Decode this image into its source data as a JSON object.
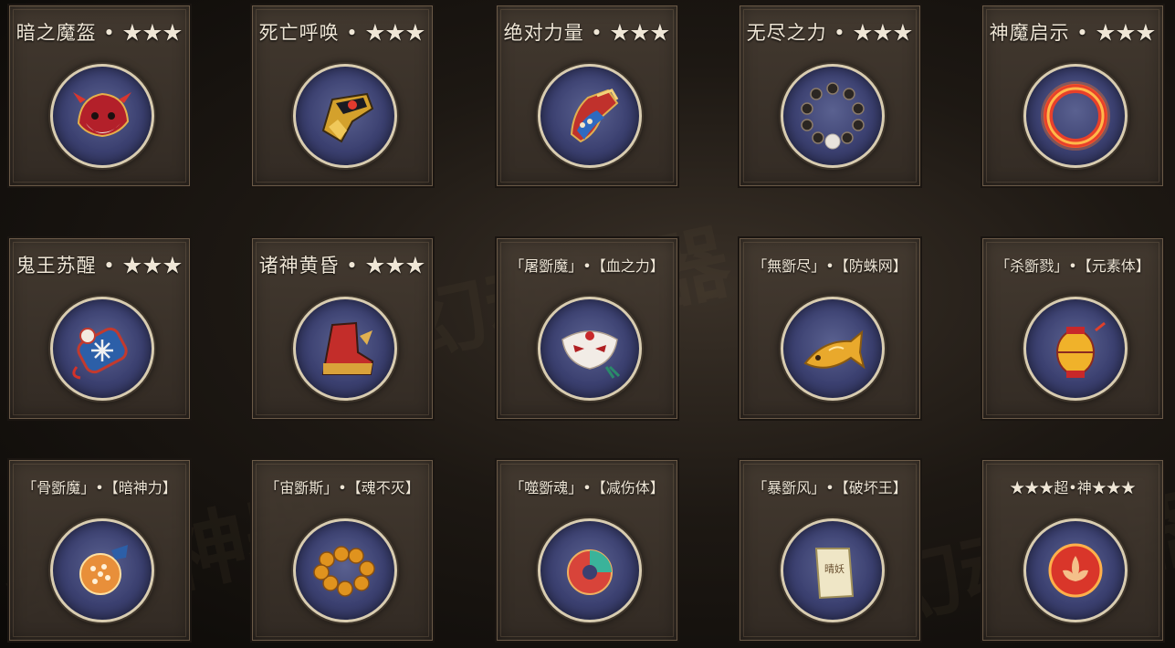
{
  "watermark_text": "幻魂神器",
  "items": [
    {
      "title": "暗之魔盔 • ★★★",
      "icon": "demon-helmet-icon",
      "small": false
    },
    {
      "title": "死亡呼唤 • ★★★",
      "icon": "golden-gauntlet-icon",
      "small": false
    },
    {
      "title": "绝对力量 • ★★★",
      "icon": "power-gauntlet-icon",
      "small": false
    },
    {
      "title": "无尽之力 • ★★★",
      "icon": "bead-bracelet-icon",
      "small": false
    },
    {
      "title": "神魔启示 • ★★★",
      "icon": "fire-ring-icon",
      "small": false
    },
    {
      "title": "鬼王苏醒 • ★★★",
      "icon": "ghost-charm-icon",
      "small": false
    },
    {
      "title": "诸神黄昏 • ★★★",
      "icon": "red-boots-icon",
      "small": false
    },
    {
      "title": "「屠斵魔」•【血之力】",
      "icon": "fox-mask-icon",
      "small": true
    },
    {
      "title": "「無斵尽」•【防蛛网】",
      "icon": "golden-fish-icon",
      "small": true
    },
    {
      "title": "「杀斵戮」•【元素体】",
      "icon": "lantern-icon",
      "small": true
    },
    {
      "title": "「骨斵魔」•【暗神力】",
      "icon": "spirit-orb-icon",
      "small": true
    },
    {
      "title": "「宙斵斯」•【魂不灭】",
      "icon": "amber-beads-icon",
      "small": true
    },
    {
      "title": "「噬斵魂」•【减伤体】",
      "icon": "jade-disc-icon",
      "small": true
    },
    {
      "title": "「暴斵风」•【破坏王】",
      "icon": "talisman-icon",
      "small": true,
      "talisman_text": "晴妖"
    },
    {
      "title": "★★★超•神★★★",
      "icon": "lotus-orb-icon",
      "small": true
    }
  ]
}
